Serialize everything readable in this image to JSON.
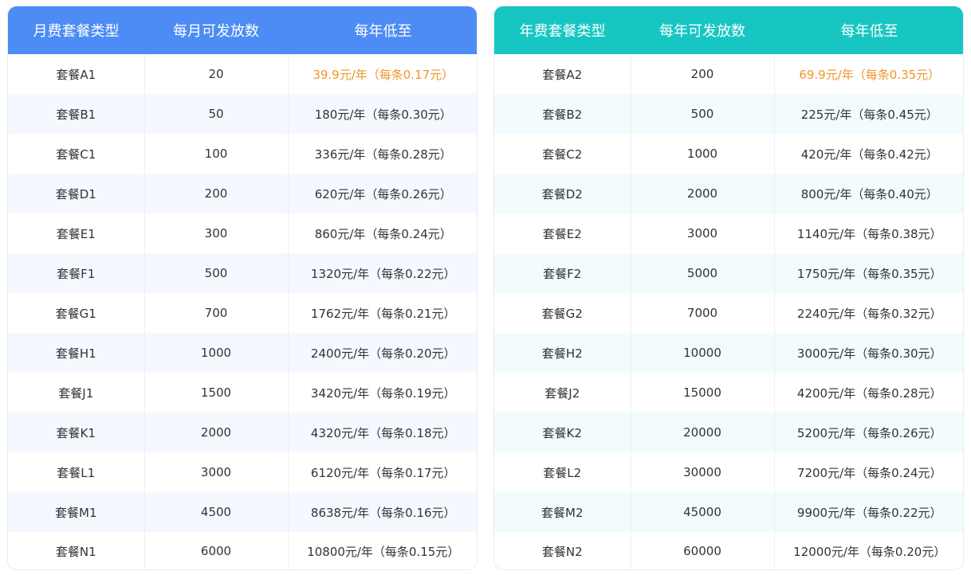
{
  "monthly": {
    "headers": [
      "月费套餐类型",
      "每月可发放数",
      "每年低至"
    ],
    "rows": [
      [
        "套餐A1",
        "20",
        "39.9元/年（每条0.17元）"
      ],
      [
        "套餐B1",
        "50",
        "180元/年（每条0.30元）"
      ],
      [
        "套餐C1",
        "100",
        "336元/年（每条0.28元）"
      ],
      [
        "套餐D1",
        "200",
        "620元/年（每条0.26元）"
      ],
      [
        "套餐E1",
        "300",
        "860元/年（每条0.24元）"
      ],
      [
        "套餐F1",
        "500",
        "1320元/年（每条0.22元）"
      ],
      [
        "套餐G1",
        "700",
        "1762元/年（每条0.21元）"
      ],
      [
        "套餐H1",
        "1000",
        "2400元/年（每条0.20元）"
      ],
      [
        "套餐J1",
        "1500",
        "3420元/年（每条0.19元）"
      ],
      [
        "套餐K1",
        "2000",
        "4320元/年（每条0.18元）"
      ],
      [
        "套餐L1",
        "3000",
        "6120元/年（每条0.17元）"
      ],
      [
        "套餐M1",
        "4500",
        "8638元/年（每条0.16元）"
      ],
      [
        "套餐N1",
        "6000",
        "10800元/年（每条0.15元）"
      ]
    ]
  },
  "yearly": {
    "headers": [
      "年费套餐类型",
      "每年可发放数",
      "每年低至"
    ],
    "rows": [
      [
        "套餐A2",
        "200",
        "69.9元/年（每条0.35元）"
      ],
      [
        "套餐B2",
        "500",
        "225元/年（每条0.45元）"
      ],
      [
        "套餐C2",
        "1000",
        "420元/年（每条0.42元）"
      ],
      [
        "套餐D2",
        "2000",
        "800元/年（每条0.40元）"
      ],
      [
        "套餐E2",
        "3000",
        "1140元/年（每条0.38元）"
      ],
      [
        "套餐F2",
        "5000",
        "1750元/年（每条0.35元）"
      ],
      [
        "套餐G2",
        "7000",
        "2240元/年（每条0.32元）"
      ],
      [
        "套餐H2",
        "10000",
        "3000元/年（每条0.30元）"
      ],
      [
        "套餐J2",
        "15000",
        "4200元/年（每条0.28元）"
      ],
      [
        "套餐K2",
        "20000",
        "5200元/年（每条0.26元）"
      ],
      [
        "套餐L2",
        "30000",
        "7200元/年（每条0.24元）"
      ],
      [
        "套餐M2",
        "45000",
        "9900元/年（每条0.22元）"
      ],
      [
        "套餐N2",
        "60000",
        "12000元/年（每条0.20元）"
      ]
    ]
  },
  "colors": {
    "monthly_header": "#4d8cf5",
    "yearly_header": "#17c6c3",
    "highlight_price": "#f0952a"
  }
}
